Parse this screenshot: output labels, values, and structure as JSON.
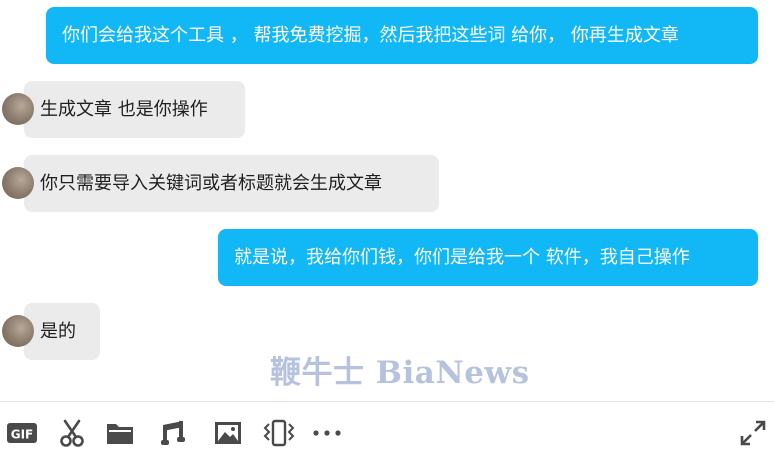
{
  "messages": [
    {
      "direction": "out",
      "text": "你们会给我这个工具 ， 帮我免费挖掘，然后我把这些词 给你， 你再生成文章"
    },
    {
      "direction": "in",
      "text": "生成文章 也是你操作"
    },
    {
      "direction": "in",
      "text": "你只需要导入关键词或者标题就会生成文章"
    },
    {
      "direction": "out",
      "text": "就是说，我给你们钱，你们是给我一个 软件，我自己操作"
    },
    {
      "direction": "in",
      "text": "是的"
    }
  ],
  "watermark": {
    "text": "鞭牛士 BiaNews"
  },
  "toolbar": {
    "gif_label": "GIF",
    "icons": [
      "gif-icon",
      "scissors-icon",
      "folder-icon",
      "music-icon",
      "image-icon",
      "shake-icon",
      "more-icon",
      "expand-icon"
    ]
  },
  "colors": {
    "outgoing_bubble": "#12b7f5",
    "incoming_bubble": "#ebebeb",
    "watermark": "#b7c3de",
    "icon": "#4a4a4a"
  }
}
